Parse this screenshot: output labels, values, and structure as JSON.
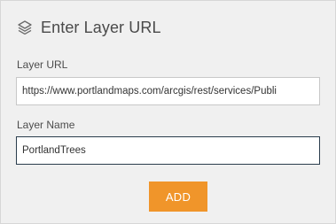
{
  "dialog": {
    "title": "Enter Layer URL",
    "icon": "layers-icon"
  },
  "fields": {
    "url": {
      "label": "Layer URL",
      "value": "https://www.portlandmaps.com/arcgis/rest/services/Publi"
    },
    "name": {
      "label": "Layer Name",
      "value": "PortlandTrees"
    }
  },
  "actions": {
    "add_label": "ADD"
  },
  "colors": {
    "panel_background": "#f0f0f0",
    "accent": "#f0952a",
    "focused_border": "#2a3d4d"
  }
}
